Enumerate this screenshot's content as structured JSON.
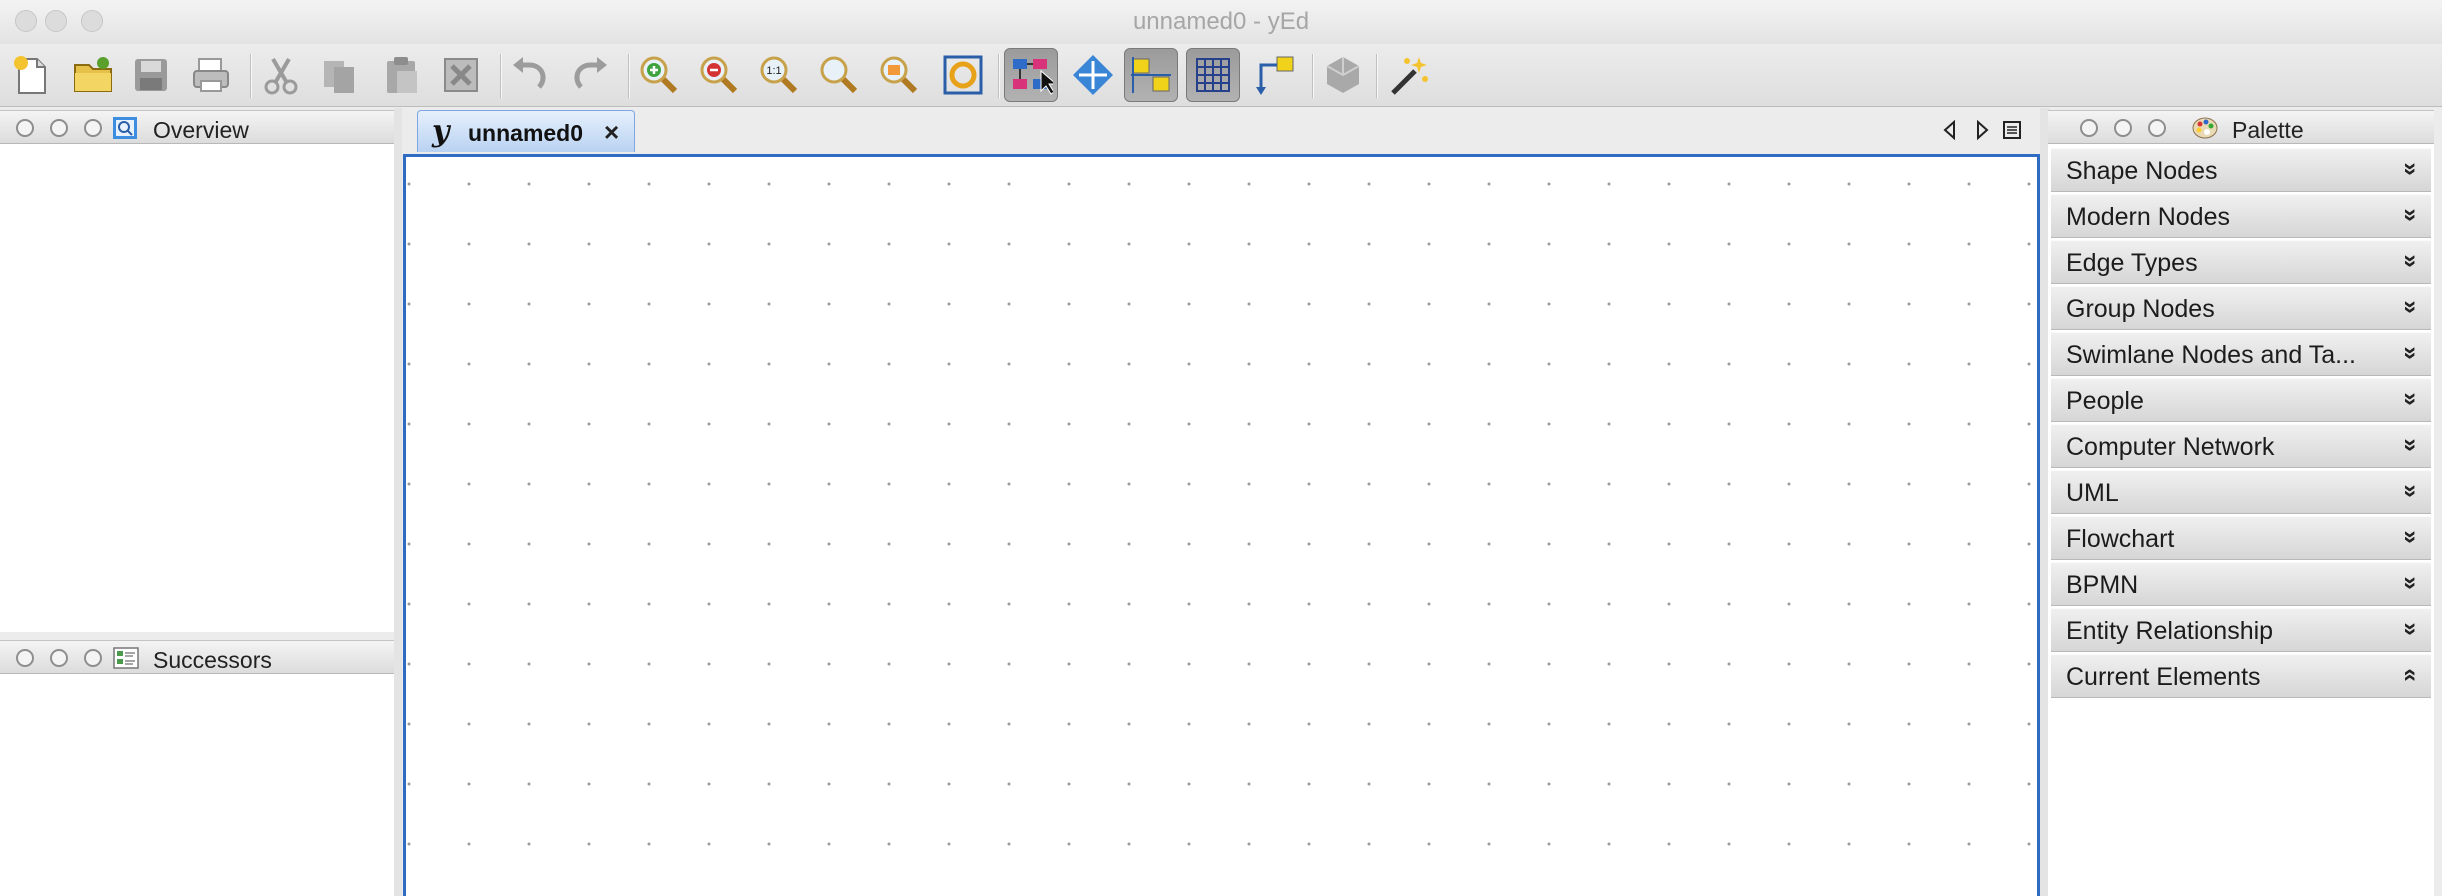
{
  "window": {
    "title": "unnamed0 - yEd"
  },
  "toolbar": {
    "buttons": [
      {
        "name": "new-document-icon"
      },
      {
        "name": "open-folder-icon"
      },
      {
        "name": "save-icon"
      },
      {
        "name": "print-icon"
      },
      {
        "name": "cut-icon"
      },
      {
        "name": "copy-icon"
      },
      {
        "name": "paste-icon"
      },
      {
        "name": "delete-icon"
      },
      {
        "name": "undo-icon"
      },
      {
        "name": "redo-icon"
      },
      {
        "name": "zoom-in-icon"
      },
      {
        "name": "zoom-out-icon"
      },
      {
        "name": "zoom-actual-size-icon",
        "text": "1:1"
      },
      {
        "name": "zoom-fit-icon"
      },
      {
        "name": "zoom-area-icon"
      },
      {
        "name": "fit-content-icon"
      },
      {
        "name": "edit-mode-icon"
      },
      {
        "name": "navigation-mode-icon"
      },
      {
        "name": "snapping-icon"
      },
      {
        "name": "grid-icon"
      },
      {
        "name": "orthogonal-edges-icon"
      },
      {
        "name": "layout-icon"
      },
      {
        "name": "magic-wand-icon"
      }
    ],
    "pressed": [
      "edit-mode-icon",
      "snapping-icon",
      "grid-icon"
    ]
  },
  "panels": {
    "overview": {
      "title": "Overview"
    },
    "successors": {
      "title": "Successors"
    },
    "palette": {
      "title": "Palette"
    }
  },
  "document_tab": {
    "label": "unnamed0",
    "logo": "y",
    "close": "×"
  },
  "palette": {
    "sections": [
      {
        "label": "Shape Nodes",
        "state": "collapsed"
      },
      {
        "label": "Modern Nodes",
        "state": "collapsed"
      },
      {
        "label": "Edge Types",
        "state": "collapsed"
      },
      {
        "label": "Group Nodes",
        "state": "collapsed"
      },
      {
        "label": "Swimlane Nodes and Ta...",
        "state": "collapsed"
      },
      {
        "label": "People",
        "state": "collapsed"
      },
      {
        "label": "Computer Network",
        "state": "collapsed"
      },
      {
        "label": "UML",
        "state": "collapsed"
      },
      {
        "label": "Flowchart",
        "state": "collapsed"
      },
      {
        "label": "BPMN",
        "state": "collapsed"
      },
      {
        "label": "Entity Relationship",
        "state": "collapsed"
      },
      {
        "label": "Current Elements",
        "state": "expanded"
      }
    ],
    "collapsed_glyph": "»",
    "expanded_glyph": "«"
  },
  "colors": {
    "canvas_border": "#2e6cc4",
    "tab_active": "#b9d2f2",
    "grid_dot": "#9c9c9c"
  }
}
